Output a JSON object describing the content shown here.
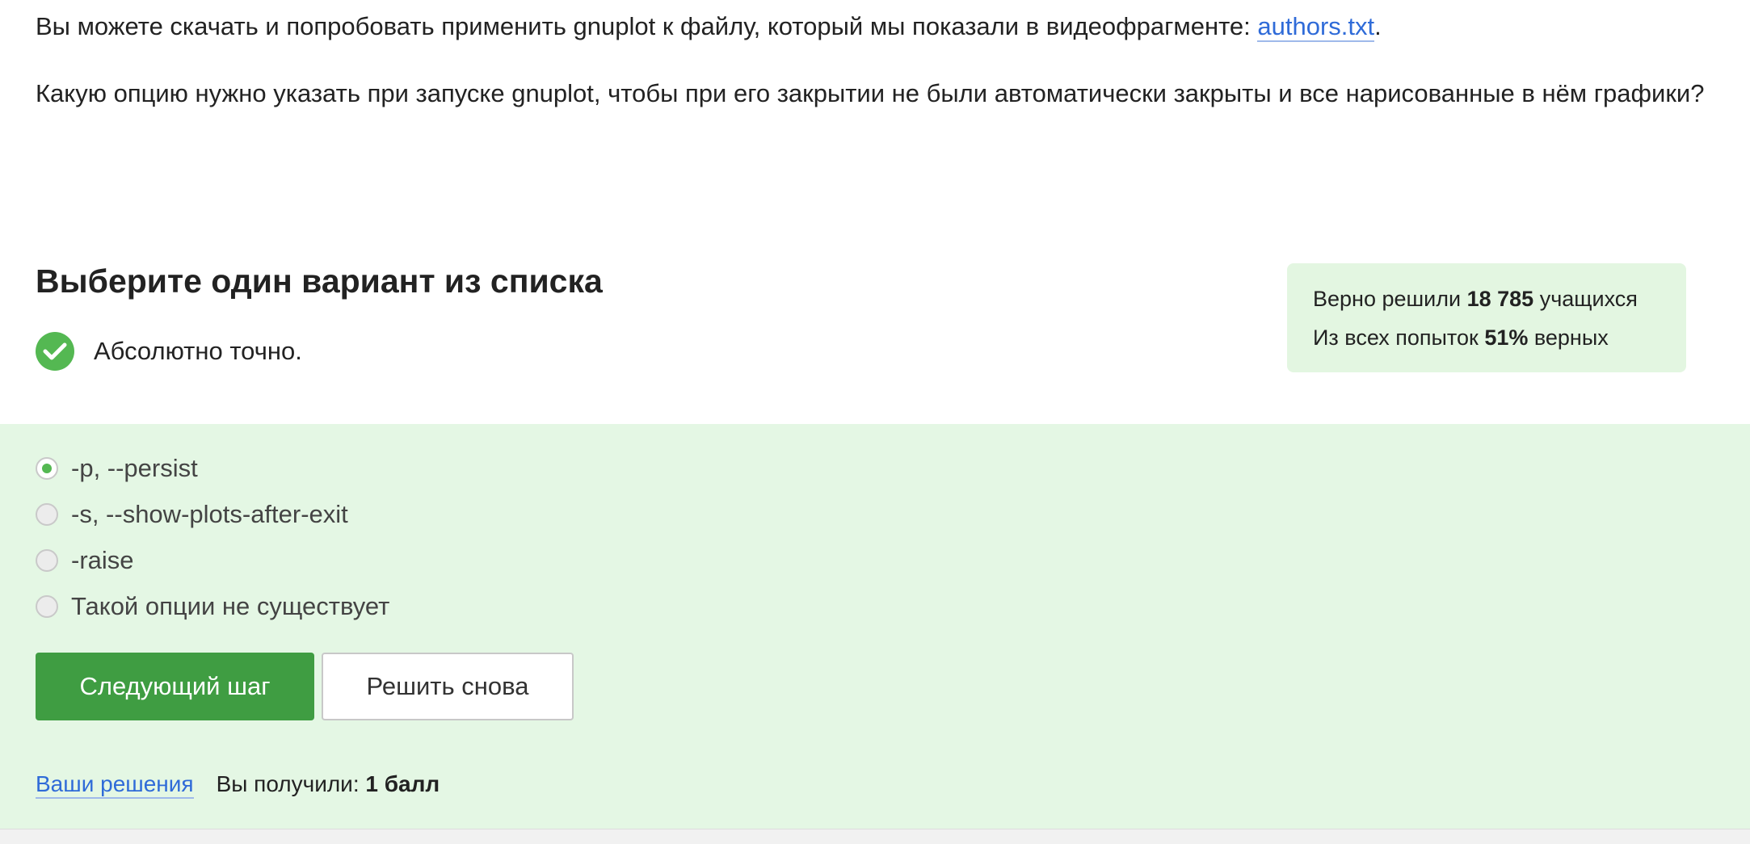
{
  "intro": {
    "download_text": "Вы можете скачать и попробовать применить gnuplot к файлу, который мы показали в видеофрагменте: ",
    "link_text": "authors.txt",
    "download_end": ".",
    "question": "Какую опцию нужно указать при запуске gnuplot, чтобы при его закрытии не были автоматически закрыты и все нарисованные в нём графики?"
  },
  "task": {
    "heading": "Выберите один вариант из списка",
    "verdict_text": "Абсолютно точно.",
    "verdict_color": "#54b852"
  },
  "stats": {
    "line1_prefix": "Верно решили ",
    "solved_count": "18 785",
    "line1_suffix": " учащихся",
    "line2_prefix": "Из всех попыток ",
    "percent": "51%",
    "line2_suffix": " верных"
  },
  "options": [
    {
      "label": "-p, --persist",
      "selected": true
    },
    {
      "label": "-s, --show-plots-after-exit",
      "selected": false
    },
    {
      "label": "-raise",
      "selected": false
    },
    {
      "label": "Такой опции не существует",
      "selected": false
    }
  ],
  "buttons": {
    "next": "Следующий шаг",
    "retry": "Решить снова"
  },
  "footer": {
    "solutions_link": "Ваши решения",
    "score_prefix": "Вы получили: ",
    "score_value": "1 балл"
  },
  "colors": {
    "accent_green": "#3f9d42",
    "panel_green": "#e4f7e4",
    "link_blue": "#2f6bd8"
  }
}
